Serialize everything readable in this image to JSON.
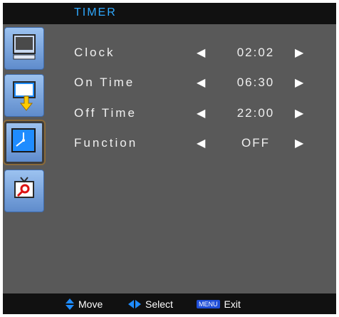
{
  "header": {
    "title": "TIMER"
  },
  "sidebar": {
    "icons": [
      "picture-monitor-icon",
      "input-source-icon",
      "timer-clock-icon",
      "setup-tools-icon"
    ]
  },
  "menu": {
    "items": [
      {
        "label": "Clock",
        "value": "02:02"
      },
      {
        "label": "On Time",
        "value": "06:30"
      },
      {
        "label": "Off Time",
        "value": "22:00"
      },
      {
        "label": "Function",
        "value": "OFF"
      }
    ]
  },
  "footer": {
    "move_label": "Move",
    "select_label": "Select",
    "menu_badge": "MENU",
    "exit_label": "Exit"
  },
  "colors": {
    "title": "#2fa9ff",
    "panel": "#595959",
    "bar": "#111111",
    "icon_accent": "#1f8cff"
  }
}
